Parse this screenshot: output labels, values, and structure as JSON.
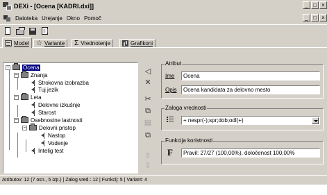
{
  "window": {
    "title": "DEXi - [Ocena [KADRI.dxi]]",
    "controls": [
      "_",
      "□",
      "×"
    ]
  },
  "menu": {
    "items": [
      "Datoteka",
      "Urejanje",
      "Okno",
      "Pomoč"
    ],
    "controls": [
      "_",
      "□",
      "×"
    ]
  },
  "toolbar": {
    "icons": [
      "new-file-icon",
      "open-folder-icon",
      "save-icon",
      "print-preview-icon"
    ]
  },
  "tabs": [
    {
      "label": "Model",
      "icon": "model-icon",
      "active": true
    },
    {
      "label": "Variante",
      "icon": "star-icon",
      "active": false
    },
    {
      "label": "Vrednotenje",
      "icon": "sigma-icon",
      "active": false
    },
    {
      "label": "Grafikoni",
      "icon": "chart-icon",
      "active": false
    }
  ],
  "tree": {
    "items": [
      {
        "label": "Ocena",
        "level": 0,
        "type": "folder",
        "selected": true
      },
      {
        "label": "Znanja",
        "level": 1,
        "type": "folder"
      },
      {
        "label": "Strokovna izobrazba",
        "level": 2,
        "type": "leaf"
      },
      {
        "label": "Tuj jezik",
        "level": 2,
        "type": "leaf"
      },
      {
        "label": "Leta",
        "level": 1,
        "type": "folder"
      },
      {
        "label": "Delovne izkušnje",
        "level": 2,
        "type": "leaf"
      },
      {
        "label": "Starost",
        "level": 2,
        "type": "leaf"
      },
      {
        "label": "Osebnostne lastnosti",
        "level": 1,
        "type": "folder"
      },
      {
        "label": "Delovni pristop",
        "level": 2,
        "type": "folder"
      },
      {
        "label": "Nastop",
        "level": 3,
        "type": "leaf"
      },
      {
        "label": "Vodenje",
        "level": 3,
        "type": "leaf"
      },
      {
        "label": "Intelig test",
        "level": 2,
        "type": "leaf"
      }
    ]
  },
  "side_toolbar": {
    "icons": [
      {
        "name": "add-attribute-icon",
        "glyph": "◁",
        "enabled": true
      },
      {
        "name": "delete-attribute-icon",
        "glyph": "✕",
        "enabled": true
      },
      {
        "name": "cut-icon",
        "glyph": "✂",
        "enabled": true
      },
      {
        "name": "copy-icon",
        "glyph": "⧉",
        "enabled": true
      },
      {
        "name": "paste-icon",
        "glyph": "▤",
        "enabled": false
      },
      {
        "name": "duplicate-icon",
        "glyph": "⧉",
        "enabled": true
      },
      {
        "name": "move-up-icon",
        "glyph": "⇧",
        "enabled": false
      },
      {
        "name": "move-down-icon",
        "glyph": "⇩",
        "enabled": false
      }
    ]
  },
  "attribute": {
    "group_title": "Atribut",
    "name_label": "Ime",
    "name_value": "Ocena",
    "desc_label": "Opis",
    "desc_value": "Ocena kandidata za delovno mesto"
  },
  "scale": {
    "group_title": "Zaloga vrednosti",
    "value": "+ nespr(-);spr;dob;odl(+)"
  },
  "function": {
    "group_title": "Funkcija koristnosti",
    "symbol": "F",
    "value": "Pravil: 27/27 (100,00%), določenost 100,00%"
  },
  "status": {
    "parts": [
      "Atributov: 12 (7 osn., 5 izp.)",
      "Zalog vred.: 12",
      "Funkcij: 5",
      "Variant: 4"
    ]
  }
}
